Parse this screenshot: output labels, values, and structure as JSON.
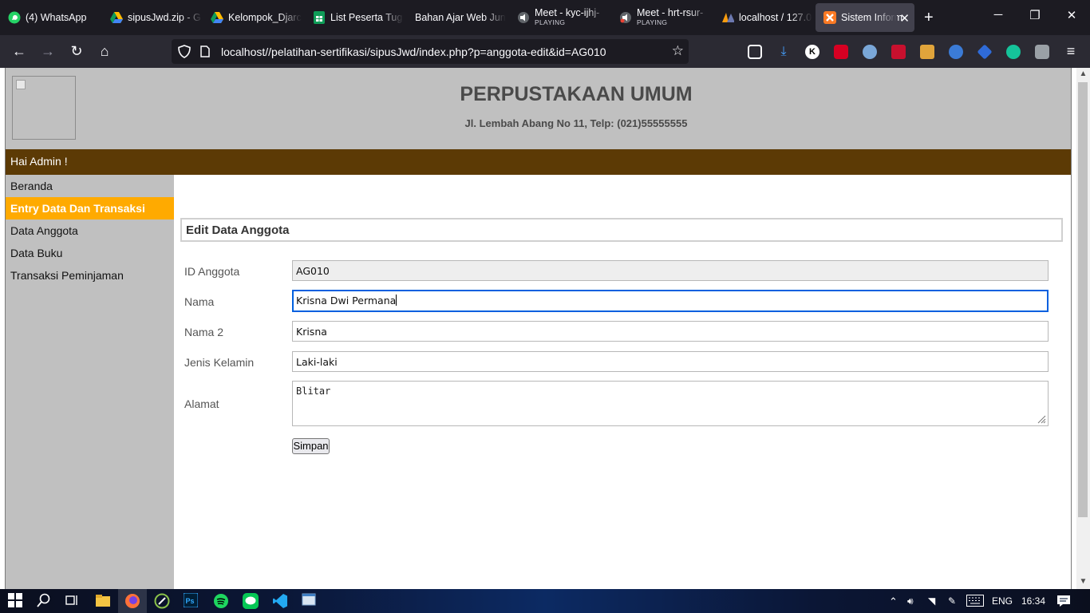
{
  "browser": {
    "tabs": [
      {
        "title": "(4) WhatsApp",
        "icon": "whatsapp-icon"
      },
      {
        "title": "sipusJwd.zip - G",
        "icon": "google-drive-icon"
      },
      {
        "title": "Kelompok_Djarc",
        "icon": "google-drive-icon"
      },
      {
        "title": "List Peserta Tug",
        "icon": "google-sheets-icon"
      },
      {
        "title": "Bahan Ajar Web Jun",
        "icon": ""
      },
      {
        "title": "Meet - kyc-ijhj-",
        "subtitle": "PLAYING",
        "icon": "meet-audio-icon"
      },
      {
        "title": "Meet - hrt-rsur-",
        "subtitle": "PLAYING",
        "icon": "meet-audio-icon"
      },
      {
        "title": "localhost / 127.0",
        "icon": "phpmyadmin-icon"
      },
      {
        "title": "Sistem Inform",
        "icon": "xampp-icon"
      }
    ],
    "url": "localhost//pelatihan-sertifikasi/sipusJwd/index.php?p=anggota-edit&id=AG010"
  },
  "page": {
    "title": "PERPUSTAKAAN UMUM",
    "subtitle": "Jl. Lembah Abang No 11, Telp: (021)55555555",
    "greeting": "Hai Admin !",
    "sidebar": [
      {
        "label": "Beranda"
      },
      {
        "label": "Entry Data Dan Transaksi"
      },
      {
        "label": "Data Anggota"
      },
      {
        "label": "Data Buku"
      },
      {
        "label": "Transaksi Peminjaman"
      }
    ],
    "panel_title": "Edit Data Anggota",
    "form": {
      "id_label": "ID Anggota",
      "id_value": "AG010",
      "nama_label": "Nama",
      "nama_value": "Krisna Dwi Permana",
      "nama2_label": "Nama 2",
      "nama2_value": "Krisna",
      "jk_label": "Jenis Kelamin",
      "jk_value": "Laki-laki",
      "alamat_label": "Alamat",
      "alamat_value": "Blitar",
      "submit_label": "Simpan"
    }
  },
  "taskbar": {
    "language": "ENG",
    "time": "16:34"
  },
  "colors": {
    "header_bg": "#c0c0c0",
    "greet_bar": "#5c3a05",
    "sidebar_active": "#ffaa00",
    "focus_ring": "#0060df"
  }
}
